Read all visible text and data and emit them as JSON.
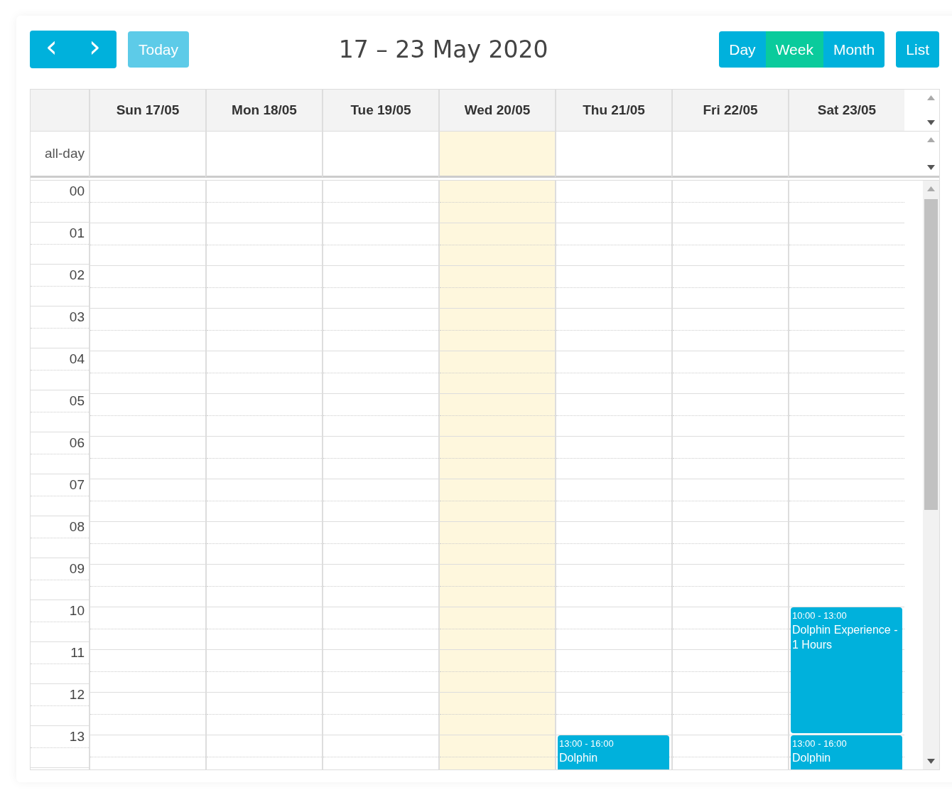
{
  "toolbar": {
    "prev": "‹",
    "next": "›",
    "today": {
      "label": "Today",
      "disabled": true
    },
    "title": "17 – 23 May 2020",
    "views": [
      {
        "label": "Day",
        "selected": false
      },
      {
        "label": "Week",
        "selected": true
      },
      {
        "label": "Month",
        "selected": false
      }
    ],
    "list": {
      "label": "List",
      "selected": false
    }
  },
  "all_day_label": "all-day",
  "days": [
    {
      "label": "Sun 17/05",
      "today": false
    },
    {
      "label": "Mon 18/05",
      "today": false
    },
    {
      "label": "Tue 19/05",
      "today": false
    },
    {
      "label": "Wed 20/05",
      "today": true
    },
    {
      "label": "Thu 21/05",
      "today": false,
      "events": [
        {
          "time": "13:00 - 16:00",
          "title": "Dolphin"
        }
      ]
    },
    {
      "label": "Fri 22/05",
      "today": false
    },
    {
      "label": "Sat 23/05",
      "today": false,
      "events": [
        {
          "time": "10:00 - 13:00",
          "title": "Dolphin Experience - 1 Hours"
        },
        {
          "time": "13:00 - 16:00",
          "title": "Dolphin"
        }
      ]
    }
  ],
  "hours": [
    "00",
    "01",
    "02",
    "03",
    "04",
    "05",
    "06",
    "07",
    "08",
    "09",
    "10",
    "11",
    "12",
    "13"
  ]
}
